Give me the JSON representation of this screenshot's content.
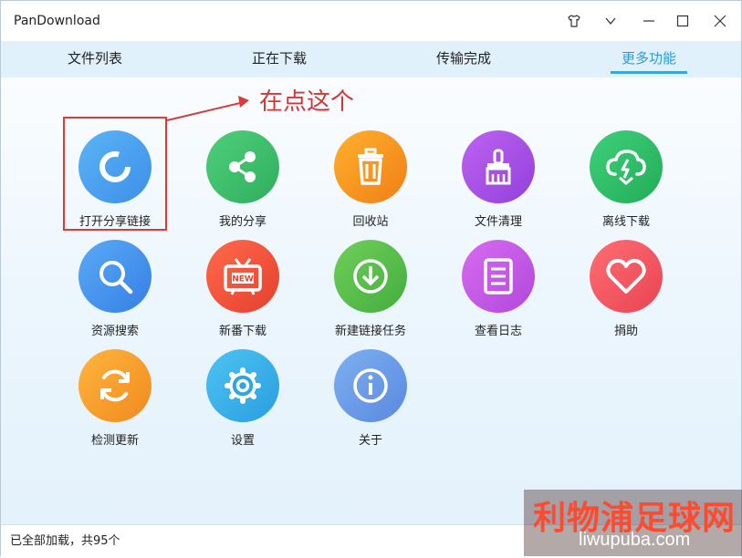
{
  "window": {
    "title": "PanDownload"
  },
  "tabs": [
    {
      "label": "文件列表",
      "active": false
    },
    {
      "label": "正在下载",
      "active": false
    },
    {
      "label": "传输完成",
      "active": false
    },
    {
      "label": "更多功能",
      "active": true
    }
  ],
  "features": [
    {
      "label": "打开分享链接",
      "icon": "share-link-ring-icon",
      "color": "#4fa8ee"
    },
    {
      "label": "我的分享",
      "icon": "share-icon",
      "color": "#3fbf6e"
    },
    {
      "label": "回收站",
      "icon": "trash-icon",
      "color": "#f59a1b"
    },
    {
      "label": "文件清理",
      "icon": "brush-icon",
      "color": "#a94fe6"
    },
    {
      "label": "离线下载",
      "icon": "cloud-download-icon",
      "color": "#32c06b"
    },
    {
      "label": "资源搜索",
      "icon": "search-icon",
      "color": "#4a95ee"
    },
    {
      "label": "新番下载",
      "icon": "tv-new-icon",
      "color": "#f0503c"
    },
    {
      "label": "新建链接任务",
      "icon": "download-circle-icon",
      "color": "#5dc04b"
    },
    {
      "label": "查看日志",
      "icon": "log-list-icon",
      "color": "#c95ae6"
    },
    {
      "label": "捐助",
      "icon": "heart-icon",
      "color": "#f25a63"
    },
    {
      "label": "检测更新",
      "icon": "refresh-icon",
      "color": "#f5a530"
    },
    {
      "label": "设置",
      "icon": "gear-icon",
      "color": "#3fb3ea"
    },
    {
      "label": "关于",
      "icon": "info-icon",
      "color": "#6f9de8"
    }
  ],
  "annotation": {
    "text": "在点这个",
    "color": "#d43535"
  },
  "statusbar": {
    "text": "已全部加载，共95个"
  },
  "watermark": {
    "line1": "利物浦足球网",
    "line2": "liwupuba.com"
  }
}
